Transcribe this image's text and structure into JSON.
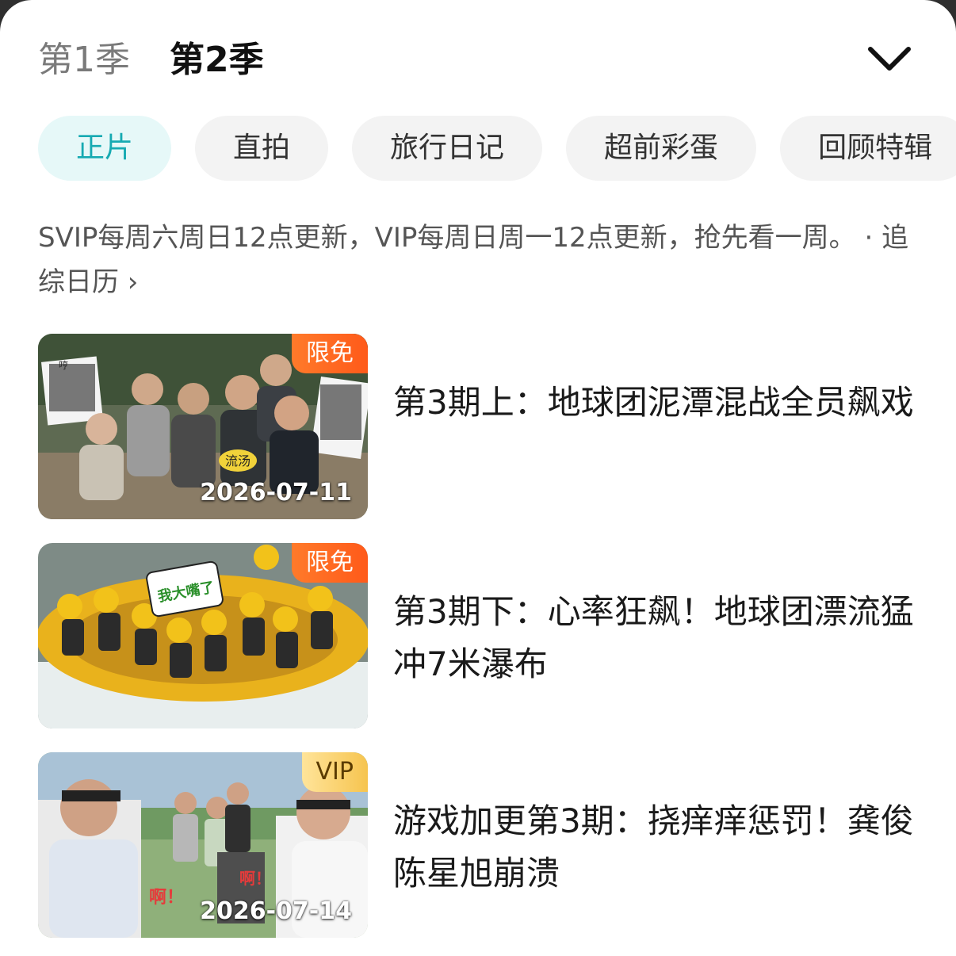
{
  "seasons": {
    "s1": "第1季",
    "s2": "第2季"
  },
  "tabs": [
    "正片",
    "直拍",
    "旅行日记",
    "超前彩蛋",
    "回顾特辑"
  ],
  "notice": {
    "text": "SVIP每周六周日12点更新，VIP每周日周一12点更新，抢先看一周。",
    "link": "· 追综日历 ›"
  },
  "episodes": [
    {
      "title": "第3期上：地球团泥潭混战全员飙戏",
      "badge": "限免",
      "date": "2026-07-11"
    },
    {
      "title": "第3期下：心率狂飙！地球团漂流猛冲7米瀑布",
      "badge": "限免",
      "date": ""
    },
    {
      "title": "游戏加更第3期：挠痒痒惩罚！龚俊陈星旭崩溃",
      "badge": "VIP",
      "date": "2026-07-14"
    }
  ],
  "thumb_overlays": {
    "ep1_caption": "流汤",
    "ep1_caption2": "哼",
    "ep2_caption": "我大嘴了",
    "ep3_caption1": "啊！",
    "ep3_caption2": "啊！"
  },
  "colors": {
    "accent": "#16aab2",
    "free_badge": "#ff6a1f",
    "vip_badge": "#f6c44f"
  },
  "icons": {
    "collapse": "chevron-down-icon"
  }
}
